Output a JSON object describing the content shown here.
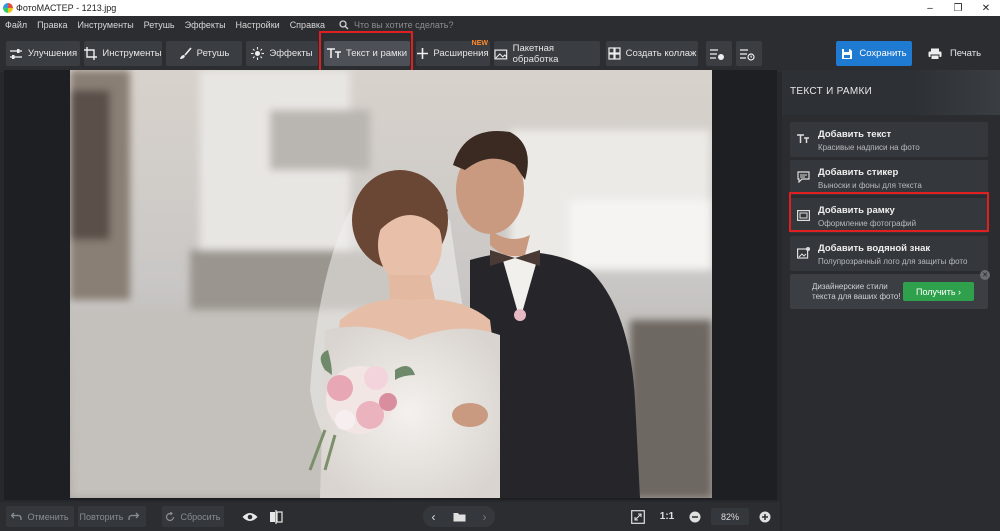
{
  "window": {
    "title": "ФотоМАСТЕР - 1213.jpg"
  },
  "menu": {
    "items": [
      "Файл",
      "Правка",
      "Инструменты",
      "Ретушь",
      "Эффекты",
      "Настройки",
      "Справка"
    ],
    "search_placeholder": "Что вы хотите сделать?"
  },
  "toolbar": {
    "tabs": [
      {
        "label": "Улучшения",
        "icon": "sliders-icon"
      },
      {
        "label": "Инструменты",
        "icon": "crop-icon"
      },
      {
        "label": "Ретушь",
        "icon": "brush-icon"
      },
      {
        "label": "Эффекты",
        "icon": "sparkle-icon"
      },
      {
        "label": "Текст и рамки",
        "icon": "text-icon",
        "active": true
      },
      {
        "label": "Расширения",
        "icon": "plus-icon",
        "badge": "NEW"
      },
      {
        "label": "Пакетная обработка",
        "icon": "images-icon"
      },
      {
        "label": "Создать коллаж",
        "icon": "collage-icon"
      }
    ],
    "save_label": "Сохранить",
    "print_label": "Печать"
  },
  "panel": {
    "title": "ТЕКСТ И РАМКИ",
    "items": [
      {
        "title": "Добавить текст",
        "subtitle": "Красивые надписи на фото",
        "icon": "text-icon"
      },
      {
        "title": "Добавить стикер",
        "subtitle": "Выноски и фоны для текста",
        "icon": "sticker-icon"
      },
      {
        "title": "Добавить рамку",
        "subtitle": "Оформление фотографий",
        "icon": "frame-icon"
      },
      {
        "title": "Добавить водяной знак",
        "subtitle": "Полупрозрачный лого для защиты фото",
        "icon": "watermark-icon"
      }
    ],
    "promo": {
      "text_line1": "Дизайнерские стили",
      "text_line2": "текста для ваших фото!",
      "button": "Получить ›"
    }
  },
  "bottombar": {
    "undo_label": "Отменить",
    "redo_label": "Повторить",
    "reset_label": "Сбросить",
    "zoom_1to1": "1:1",
    "zoom_level": "82%"
  },
  "colors": {
    "accent": "#1f7ad1",
    "highlight": "#e02020",
    "promo_button": "#2fa04c",
    "new_badge": "#ff8a2a"
  }
}
